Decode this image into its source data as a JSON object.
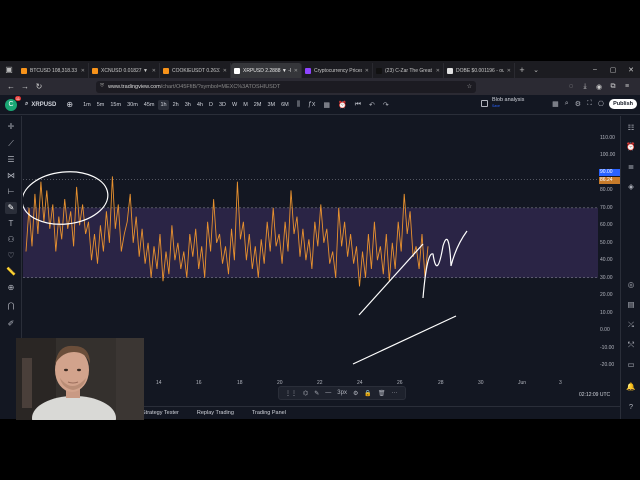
{
  "tabs": [
    {
      "title": "BTCUSD 108,318.33 ▼",
      "color": "#f7931a",
      "active": false
    },
    {
      "title": "XCNUSD 0.01827 ▼ -",
      "color": "#f7931a",
      "active": false
    },
    {
      "title": "COOKIEUSDT 0.2631 -",
      "color": "#f7931a",
      "active": false
    },
    {
      "title": "XRPUSD 2.2888 ▼ -0.",
      "color": "#ffffff",
      "active": true
    },
    {
      "title": "Cryptocurrency Prices",
      "color": "#8e44ff",
      "active": false
    },
    {
      "title": "(23) C-Zar The Great (",
      "color": "#111111",
      "active": false
    },
    {
      "title": "DOBE $0.001196 - ou",
      "color": "#e0e0e0",
      "active": false
    }
  ],
  "address": {
    "host": "www.tradingview.com",
    "path": "/chart/O45FfiB/?symbol=MEXC%3ATOSHIUSDT"
  },
  "toolbar": {
    "symbol": "XRPUSD",
    "avatar_badge": "11",
    "intervals": [
      "1m",
      "5m",
      "15m",
      "30m",
      "45m",
      "1h",
      "2h",
      "3h",
      "4h",
      "D",
      "3D",
      "W",
      "M",
      "2M",
      "3M",
      "6M"
    ],
    "active_interval": "1h",
    "blob_label": "Blob analysis",
    "blob_sub": "Save",
    "publish_label": "Publish"
  },
  "chart": {
    "y_ticks": [
      "110.00",
      "100.00",
      "90.00",
      "80.00",
      "70.00",
      "60.00",
      "50.00",
      "40.00",
      "30.00",
      "20.00",
      "10.00",
      "0.00",
      "-10.00",
      "-20.00"
    ],
    "y_ticks_values": [
      110,
      100,
      90,
      80,
      70,
      60,
      50,
      40,
      30,
      20,
      10,
      0,
      -10,
      -20
    ],
    "label_upper": "90.00",
    "label_current": "86.24",
    "x_ticks": [
      "14",
      "16",
      "18",
      "20",
      "22",
      "24",
      "26",
      "28",
      "30",
      "Jun",
      "3"
    ],
    "time_label": "02:12:09 UTC",
    "line_color": "#e8912f",
    "band_color": "#7e57c2",
    "band_range": [
      30,
      70
    ]
  },
  "chart_data": {
    "type": "line",
    "title": "",
    "xlabel": "",
    "ylabel": "",
    "ylim": [
      -20,
      110
    ],
    "band": [
      30,
      70
    ],
    "upper_line": 86.24,
    "x_ticks": [
      "14",
      "16",
      "18",
      "20",
      "22",
      "24",
      "26",
      "28",
      "30",
      "Jun",
      "3"
    ],
    "series": [
      {
        "values": [
          45,
          70,
          48,
          78,
          55,
          85,
          62,
          80,
          58,
          72,
          45,
          65,
          52,
          75,
          58,
          68,
          48,
          82,
          60,
          72,
          55,
          62,
          40,
          55,
          38,
          60,
          45,
          68,
          50,
          88,
          58,
          72,
          45,
          55,
          62,
          78,
          50,
          65,
          42,
          58,
          38,
          50,
          30,
          48,
          35,
          55,
          28,
          45,
          32,
          60,
          40,
          50,
          35,
          45,
          30,
          55,
          42,
          58,
          35,
          48,
          30,
          62,
          45,
          75,
          50,
          55,
          38,
          48,
          32,
          58,
          40,
          85,
          52,
          62,
          40,
          55,
          35,
          48,
          30,
          52,
          38,
          62,
          45,
          70,
          48,
          55,
          38,
          62,
          45,
          80,
          55,
          65,
          42,
          58,
          40,
          52,
          35,
          62,
          48,
          72,
          50,
          58,
          38,
          45,
          30,
          70,
          48,
          62,
          42,
          55,
          38,
          48,
          25,
          45,
          30,
          55,
          35,
          62,
          40,
          48,
          32,
          55,
          28,
          50,
          35,
          62,
          45,
          78,
          55,
          68,
          42,
          48,
          35,
          55,
          30,
          48
        ]
      }
    ]
  },
  "bottom": {
    "float_weight": "3px",
    "panels": [
      "Strategy Tester",
      "Replay Trading",
      "Trading Panel"
    ]
  }
}
